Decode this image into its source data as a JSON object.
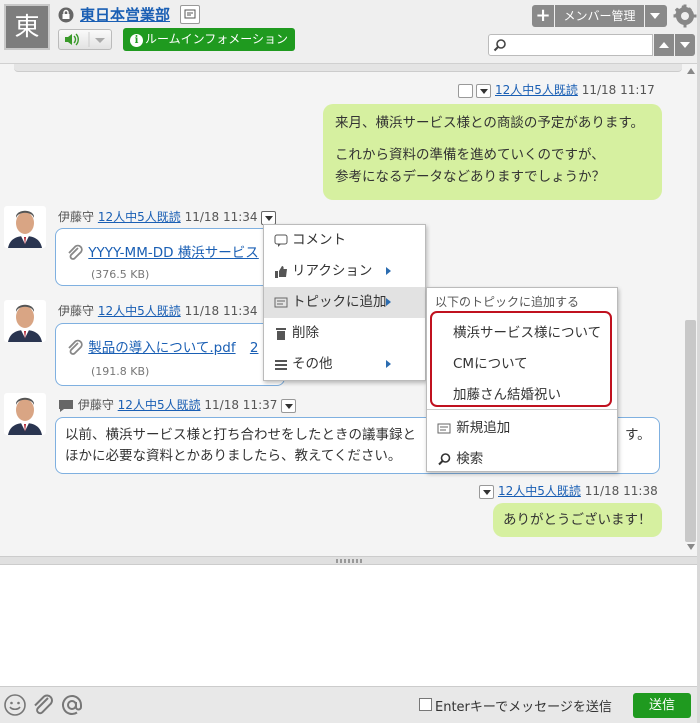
{
  "header": {
    "room_initial": "東",
    "room_name": "東日本営業部",
    "room_info_label": "ルームインフォメーション",
    "member_button": "メンバー管理",
    "search_value": ""
  },
  "messages": [
    {
      "read": "12人中5人既読",
      "time": "11/18 11:17",
      "lines": [
        "来月、横浜サービス様との商談の予定があります。",
        "",
        "これから資料の準備を進めていくのですが、",
        "参考になるデータなどありますでしょうか？"
      ]
    },
    {
      "sender": "伊藤守",
      "read": "12人中5人既読",
      "time": "11/18 11:34",
      "file": "YYYY-MM-DD 横浜サービス",
      "size": "(376.5 KB)"
    },
    {
      "sender": "伊藤守",
      "read": "12人中5人既読",
      "time": "11/18 11:34",
      "file": "製品の導入について.pdf",
      "file_tail": "2",
      "size": "(191.8 KB)"
    },
    {
      "sender": "伊藤守",
      "read": "12人中5人既読",
      "time": "11/18 11:37",
      "lines": [
        "以前、横浜サービス様と打ち合わせをしたときの議事録と",
        "ほかに必要な資料とかありましたら、教えてください。"
      ],
      "tail": "す。"
    },
    {
      "read": "12人中5人既読",
      "time": "11/18 11:38",
      "text": "ありがとうございます！"
    }
  ],
  "context_menu": {
    "items": [
      "コメント",
      "リアクション",
      "トピックに追加",
      "削除",
      "その他"
    ]
  },
  "topic_submenu": {
    "heading": "以下のトピックに追加する",
    "topics": [
      "横浜サービス様について",
      "CMについて",
      "加藤さん結婚祝い"
    ],
    "new_label": "新規追加",
    "search_label": "検索"
  },
  "footer": {
    "enter_label": "Enterキーでメッセージを送信",
    "send_label": "送信"
  },
  "colors": {
    "accent_green": "#1f9a1f",
    "link_blue": "#1a5fb4",
    "my_bubble": "#d6f0a0",
    "highlight_red": "#c0111f"
  }
}
